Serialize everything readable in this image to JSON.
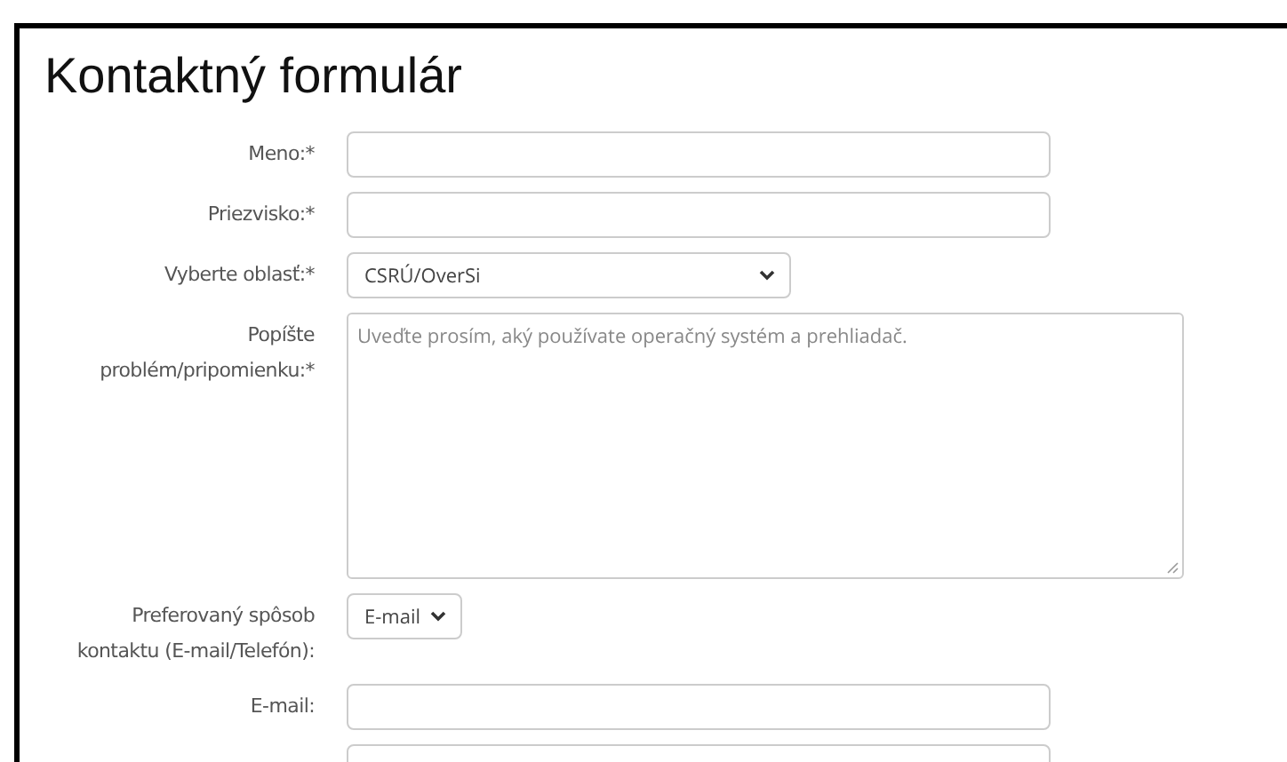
{
  "title": "Kontaktný formulár",
  "fields": [
    {
      "label": "Meno:*",
      "kind": "text"
    },
    {
      "label": "Priezvisko:*",
      "kind": "text"
    },
    {
      "label": "Vyberte oblasť:*",
      "kind": "select",
      "value": "CSRÚ/OverSi"
    },
    {
      "label": "Popíšte problém/pripomienku:*",
      "kind": "textarea",
      "placeholder": "Uveďte prosím, aký používate operačný systém a prehliadač."
    },
    {
      "label": "Preferovaný spôsob kontaktu (E-mail/Telefón):",
      "kind": "select",
      "value": "E-mail"
    },
    {
      "label": "E-mail:",
      "kind": "text"
    },
    {
      "kind": "text"
    }
  ]
}
